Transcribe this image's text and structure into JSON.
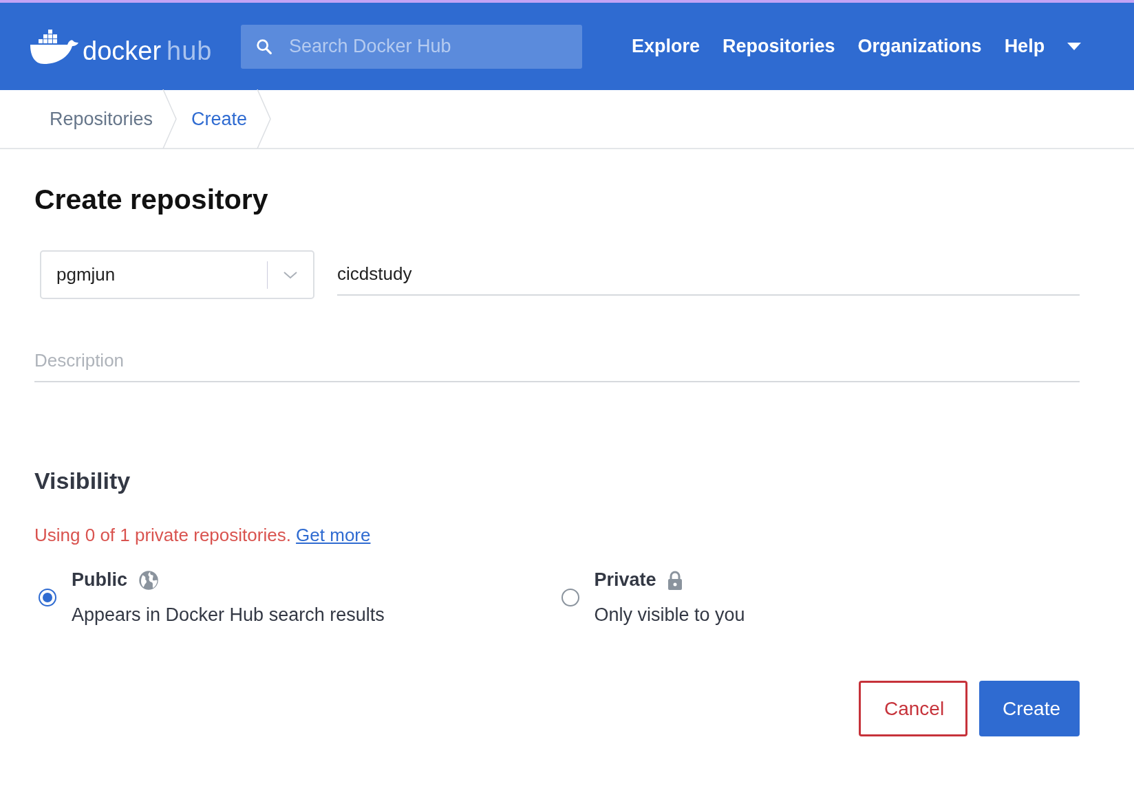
{
  "header": {
    "logo": {
      "brand": "docker",
      "product": "hub"
    },
    "search": {
      "placeholder": "Search Docker Hub"
    },
    "nav": [
      "Explore",
      "Repositories",
      "Organizations",
      "Help"
    ]
  },
  "breadcrumb": [
    {
      "label": "Repositories",
      "selected": false
    },
    {
      "label": "Create",
      "selected": true
    }
  ],
  "title": "Create repository",
  "form": {
    "namespace": "pgmjun",
    "name": "cicdstudy",
    "description": {
      "placeholder": "Description"
    }
  },
  "visibility": {
    "heading": "Visibility",
    "notice": "Using 0 of 1 private repositories.",
    "notice_link": "Get more",
    "options": [
      {
        "kind": "public",
        "label": "Public",
        "description": "Appears in Docker Hub search results",
        "selected": true
      },
      {
        "kind": "private",
        "label": "Private",
        "description": "Only visible to you",
        "selected": false
      }
    ]
  },
  "buttons": [
    {
      "kind": "secondary",
      "label": "Cancel"
    },
    {
      "kind": "primary",
      "label": "Create"
    }
  ]
}
